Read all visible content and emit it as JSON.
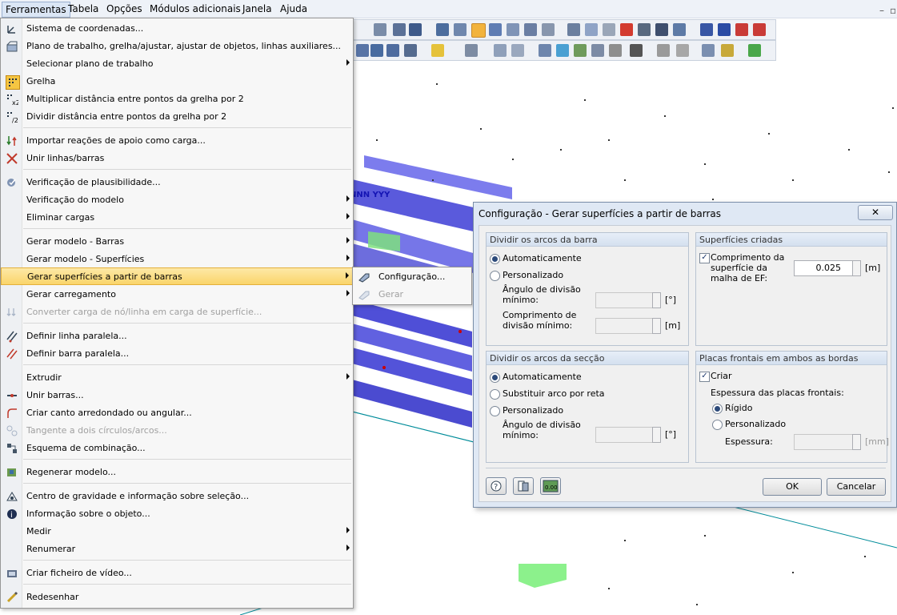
{
  "menubar": {
    "items": [
      "Ferramentas",
      "Tabela",
      "Opções",
      "Módulos adicionais",
      "Janela",
      "Ajuda"
    ]
  },
  "viewport": {
    "label": "NNN YYY"
  },
  "context_menu": {
    "items": [
      {
        "label": "Sistema de coordenadas...",
        "icon": "coordinate-system-icon",
        "disabled": false,
        "submenu": false
      },
      {
        "label": "Plano de trabalho, grelha/ajustar, ajustar de objetos, linhas auxiliares...",
        "icon": "work-plane-icon",
        "disabled": false,
        "submenu": false
      },
      {
        "label": "Selecionar plano de trabalho",
        "icon": "",
        "disabled": false,
        "submenu": true
      },
      {
        "label": "Grelha",
        "icon": "grid-icon",
        "disabled": false,
        "submenu": false
      },
      {
        "label": "Multiplicar distância entre pontos da grelha por 2",
        "icon": "grid-multiply-icon",
        "disabled": false,
        "submenu": false
      },
      {
        "label": "Dividir distância entre pontos da grelha por 2",
        "icon": "grid-divide-icon",
        "disabled": false,
        "submenu": false
      },
      {
        "label": "Importar reações de apoio como carga...",
        "icon": "import-reactions-icon",
        "disabled": false,
        "submenu": false
      },
      {
        "label": "Unir linhas/barras",
        "icon": "join-lines-icon",
        "disabled": false,
        "submenu": false
      },
      {
        "label": "Verificação de plausibilidade...",
        "icon": "plausibility-check-icon",
        "disabled": false,
        "submenu": false
      },
      {
        "label": "Verificação do modelo",
        "icon": "",
        "disabled": false,
        "submenu": true
      },
      {
        "label": "Eliminar cargas",
        "icon": "",
        "disabled": false,
        "submenu": true
      },
      {
        "label": "Gerar modelo - Barras",
        "icon": "",
        "disabled": false,
        "submenu": true
      },
      {
        "label": "Gerar modelo - Superfícies",
        "icon": "",
        "disabled": false,
        "submenu": true
      },
      {
        "label": "Gerar superfícies a partir de barras",
        "icon": "",
        "disabled": false,
        "submenu": true
      },
      {
        "label": "Gerar carregamento",
        "icon": "",
        "disabled": false,
        "submenu": true
      },
      {
        "label": "Converter carga de nó/linha em carga de superfície...",
        "icon": "convert-load-icon",
        "disabled": true,
        "submenu": false
      },
      {
        "label": "Definir linha paralela...",
        "icon": "parallel-line-icon",
        "disabled": false,
        "submenu": false
      },
      {
        "label": "Definir barra paralela...",
        "icon": "parallel-member-icon",
        "disabled": false,
        "submenu": false
      },
      {
        "label": "Extrudir",
        "icon": "",
        "disabled": false,
        "submenu": true
      },
      {
        "label": "Unir barras...",
        "icon": "join-members-icon",
        "disabled": false,
        "submenu": false
      },
      {
        "label": "Criar canto arredondado ou angular...",
        "icon": "rounded-corner-icon",
        "disabled": false,
        "submenu": false
      },
      {
        "label": "Tangente a dois círculos/arcos...",
        "icon": "tangent-icon",
        "disabled": true,
        "submenu": false
      },
      {
        "label": "Esquema de combinação...",
        "icon": "combination-scheme-icon",
        "disabled": false,
        "submenu": false
      },
      {
        "label": "Regenerar modelo...",
        "icon": "regenerate-model-icon",
        "disabled": false,
        "submenu": false
      },
      {
        "label": "Centro de gravidade e informação sobre seleção...",
        "icon": "center-gravity-icon",
        "disabled": false,
        "submenu": false
      },
      {
        "label": "Informação sobre o objeto...",
        "icon": "info-icon",
        "disabled": false,
        "submenu": false
      },
      {
        "label": "Medir",
        "icon": "",
        "disabled": false,
        "submenu": true
      },
      {
        "label": "Renumerar",
        "icon": "",
        "disabled": false,
        "submenu": true
      },
      {
        "label": "Criar ficheiro de vídeo...",
        "icon": "video-file-icon",
        "disabled": false,
        "submenu": false
      },
      {
        "label": "Redesenhar",
        "icon": "redraw-icon",
        "disabled": false,
        "submenu": false
      }
    ],
    "highlighted_index": 13
  },
  "submenu": {
    "items": [
      {
        "label": "Configuração...",
        "icon": "settings-icon",
        "disabled": false
      },
      {
        "label": "Gerar",
        "icon": "generate-icon",
        "disabled": true
      }
    ]
  },
  "dialog": {
    "title": "Configuração - Gerar superfícies a partir de barras",
    "close_label": "✕",
    "member_arcs": {
      "title": "Dividir os arcos da barra",
      "auto_label": "Automaticamente",
      "custom_label": "Personalizado",
      "min_angle_label": "Ângulo de divisão mínimo:",
      "min_angle_unit": "[°]",
      "min_length_label": "Comprimento de divisão mínimo:",
      "min_length_unit": "[m]",
      "selected": "auto"
    },
    "created_surfaces": {
      "title": "Superfícies criadas",
      "mesh_length_label": "Comprimento da superfície da malha de EF:",
      "mesh_length_value": "0.025",
      "mesh_length_unit": "[m]",
      "checked": true
    },
    "section_arcs": {
      "title": "Dividir os arcos da secção",
      "auto_label": "Automaticamente",
      "replace_label": "Substituir arco por reta",
      "custom_label": "Personalizado",
      "min_angle_label": "Ângulo de divisão mínimo:",
      "min_angle_unit": "[°]",
      "selected": "auto"
    },
    "end_plates": {
      "title": "Placas frontais em ambos as bordas",
      "create_label": "Criar",
      "create_checked": true,
      "thickness_title": "Espessura das placas frontais:",
      "rigid_label": "Rígido",
      "custom_label": "Personalizado",
      "thickness_label": "Espessura:",
      "thickness_unit": "[mm]",
      "selected": "rigid"
    },
    "ok_label": "OK",
    "cancel_label": "Cancelar"
  }
}
